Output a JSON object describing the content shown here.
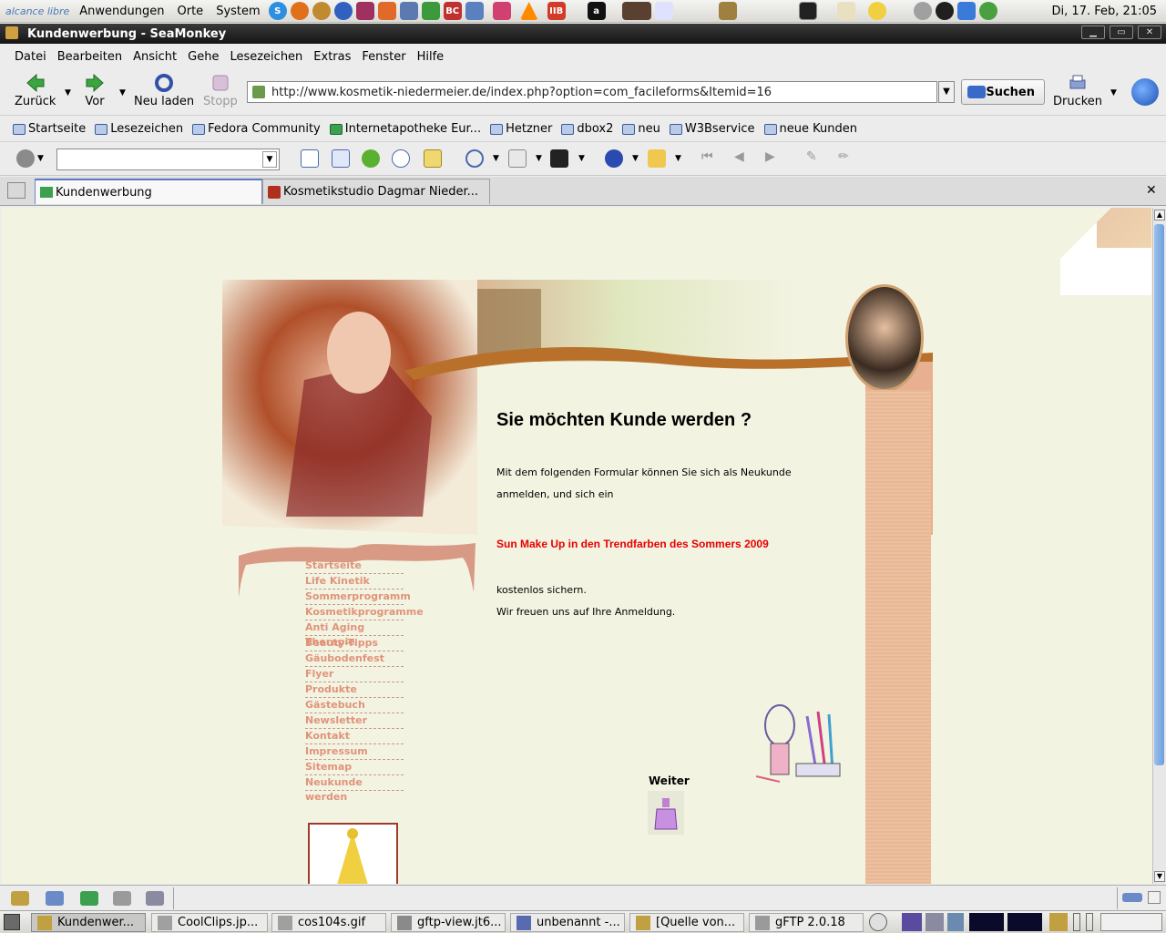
{
  "panel": {
    "logo": "alcance libre",
    "menus": [
      "Anwendungen",
      "Orte",
      "System"
    ],
    "clock": "Di, 17. Feb, 21:05"
  },
  "window": {
    "title": "Kundenwerbung - SeaMonkey"
  },
  "menubar": [
    "Datei",
    "Bearbeiten",
    "Ansicht",
    "Gehe",
    "Lesezeichen",
    "Extras",
    "Fenster",
    "Hilfe"
  ],
  "nav": {
    "back": "Zurück",
    "forward": "Vor",
    "reload": "Neu laden",
    "stop": "Stopp",
    "url": "http://www.kosmetik-niedermeier.de/index.php?option=com_facileforms&Itemid=16",
    "search": "Suchen",
    "print": "Drucken"
  },
  "bookmarks": [
    "Startseite",
    "Lesezeichen",
    "Fedora Community",
    "Internetapotheke Eur...",
    "Hetzner",
    "dbox2",
    "neu",
    "W3Bservice",
    "neue Kunden"
  ],
  "tabs": [
    {
      "label": "Kundenwerbung",
      "active": true
    },
    {
      "label": "Kosmetikstudio Dagmar Nieder..."
    }
  ],
  "page": {
    "heading": "Sie möchten Kunde werden ?",
    "intro_line1": "Mit dem folgenden Formular können Sie sich als Neukunde",
    "intro_line2": "anmelden, und sich ein",
    "promo": "Sun Make Up in den Trendfarben des Sommers 2009",
    "outro_line1": "kostenlos sichern.",
    "outro_line2": "Wir freuen uns auf Ihre Anmeldung.",
    "weiter": "Weiter",
    "nav_links": [
      "Startseite",
      "Life Kinetik",
      "Sommerprogramm",
      "Kosmetikprogramme",
      "Anti Aging Therapie",
      "Beauty-Tipps",
      "Gäubodenfest",
      "Flyer",
      "Produkte",
      "Gästebuch",
      "Newsletter",
      "Kontakt",
      "Impressum",
      "Sitemap",
      "Neukunde werden"
    ],
    "accent_color": "#e80000",
    "link_color": "#e0947a"
  },
  "taskbar": [
    {
      "label": "Kundenwer...",
      "active": true
    },
    {
      "label": "CoolClips.jp..."
    },
    {
      "label": "cos104s.gif"
    },
    {
      "label": "gftp-view.jt6..."
    },
    {
      "label": "unbenannt -..."
    },
    {
      "label": "[Quelle von..."
    },
    {
      "label": "gFTP 2.0.18"
    }
  ]
}
